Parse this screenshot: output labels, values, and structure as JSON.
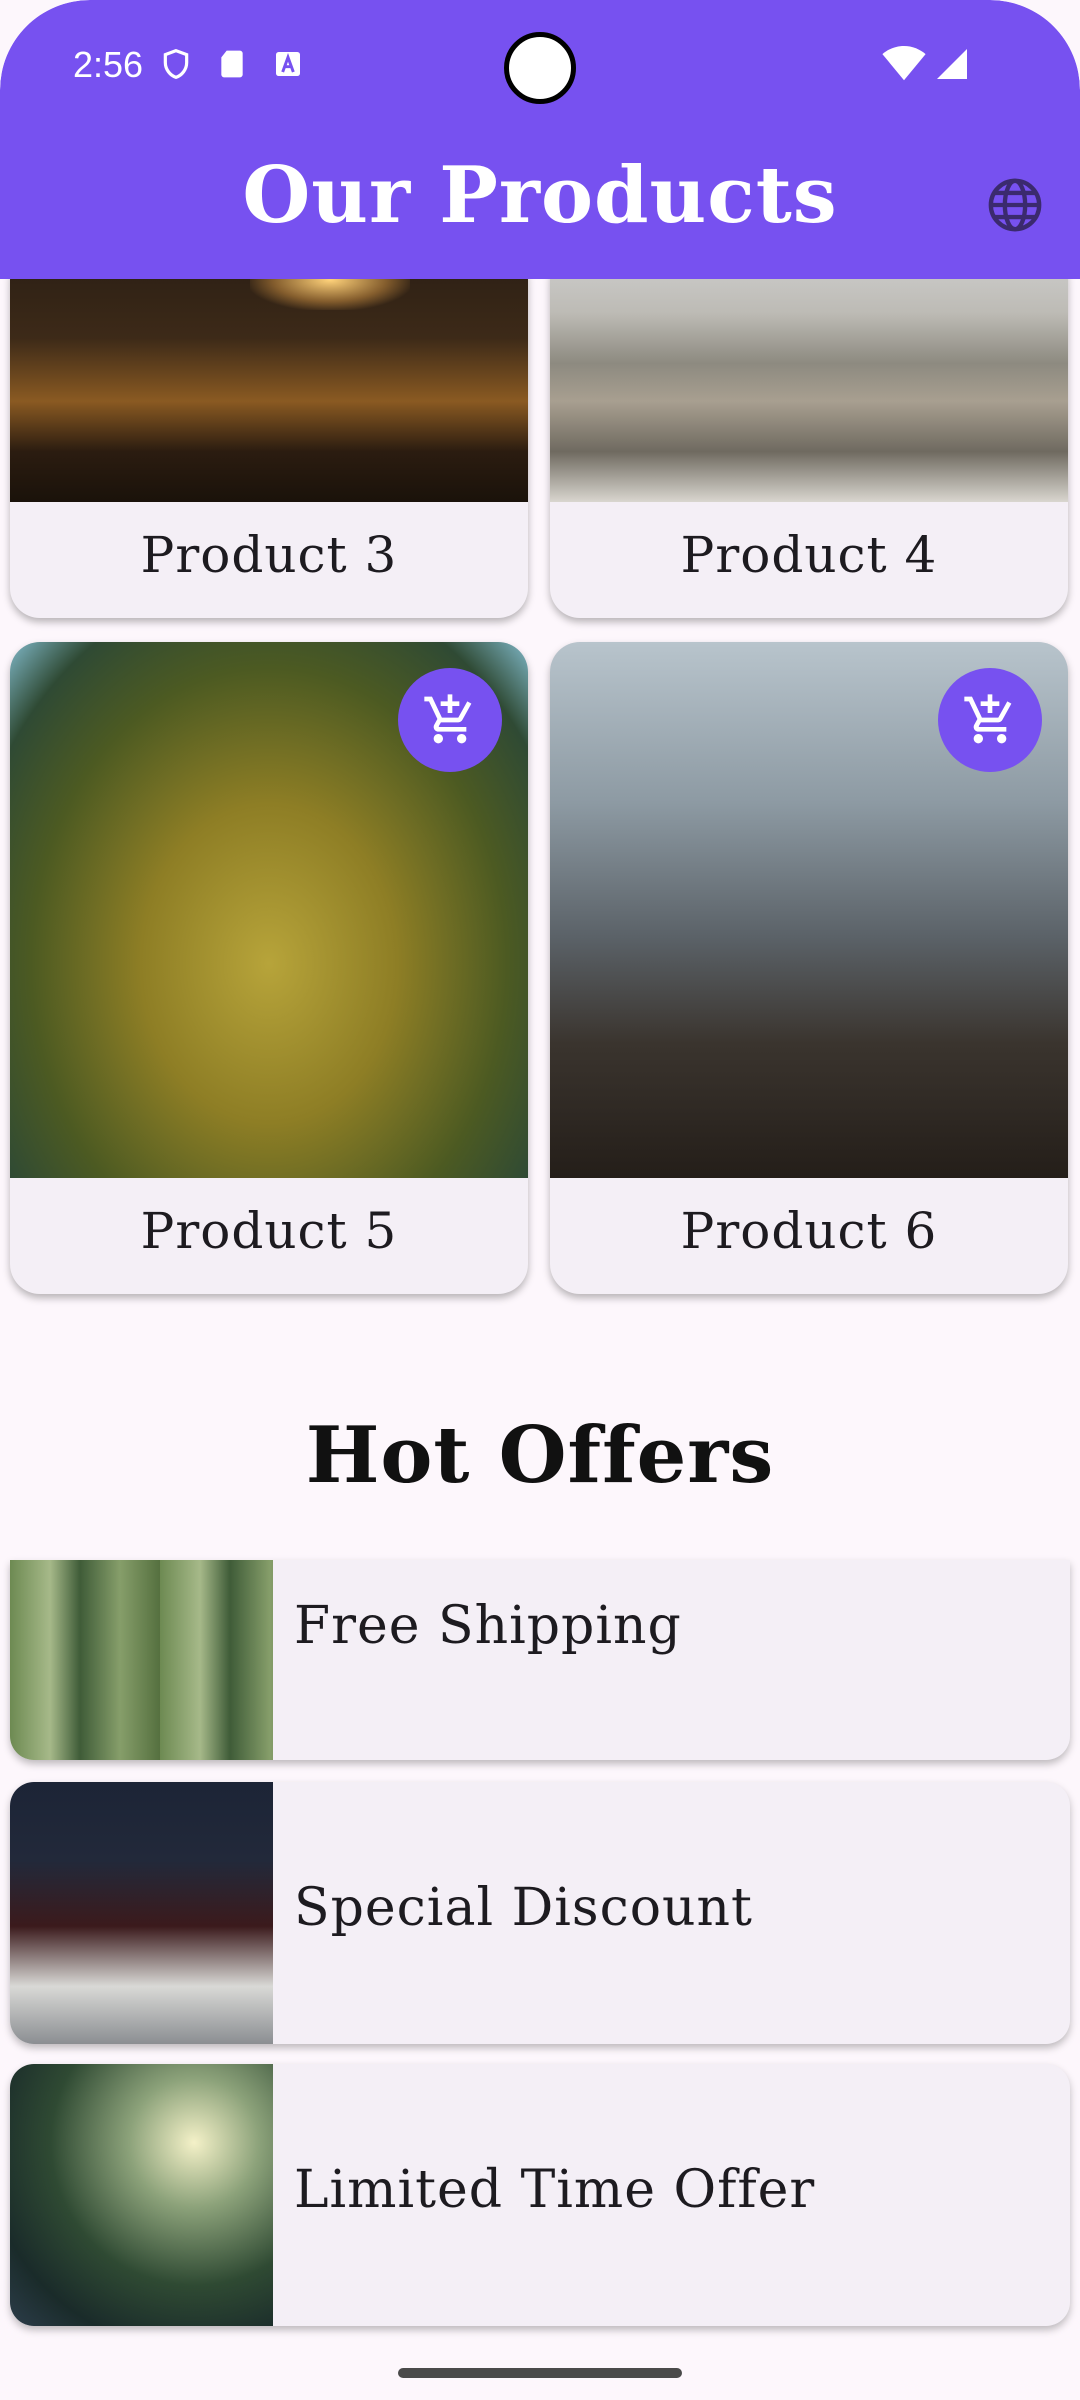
{
  "status_bar": {
    "time": "2:56"
  },
  "app_bar": {
    "title": "Our Products"
  },
  "products": [
    {
      "label": "Product 3",
      "has_cart": false
    },
    {
      "label": "Product 4",
      "has_cart": false
    },
    {
      "label": "Product 5",
      "has_cart": true
    },
    {
      "label": "Product 6",
      "has_cart": true
    }
  ],
  "offers_section": {
    "title": "Hot Offers",
    "items": [
      {
        "label": "Free Shipping"
      },
      {
        "label": "Special Discount"
      },
      {
        "label": "Limited Time Offer"
      }
    ]
  },
  "colors": {
    "primary": "#7751f0",
    "card": "#f4eff6",
    "background": "#fdf7fc"
  },
  "icons": [
    "shield-icon",
    "sd-card-icon",
    "font-a-icon",
    "wifi-icon",
    "signal-icon",
    "globe-icon",
    "add-shopping-cart-icon"
  ]
}
